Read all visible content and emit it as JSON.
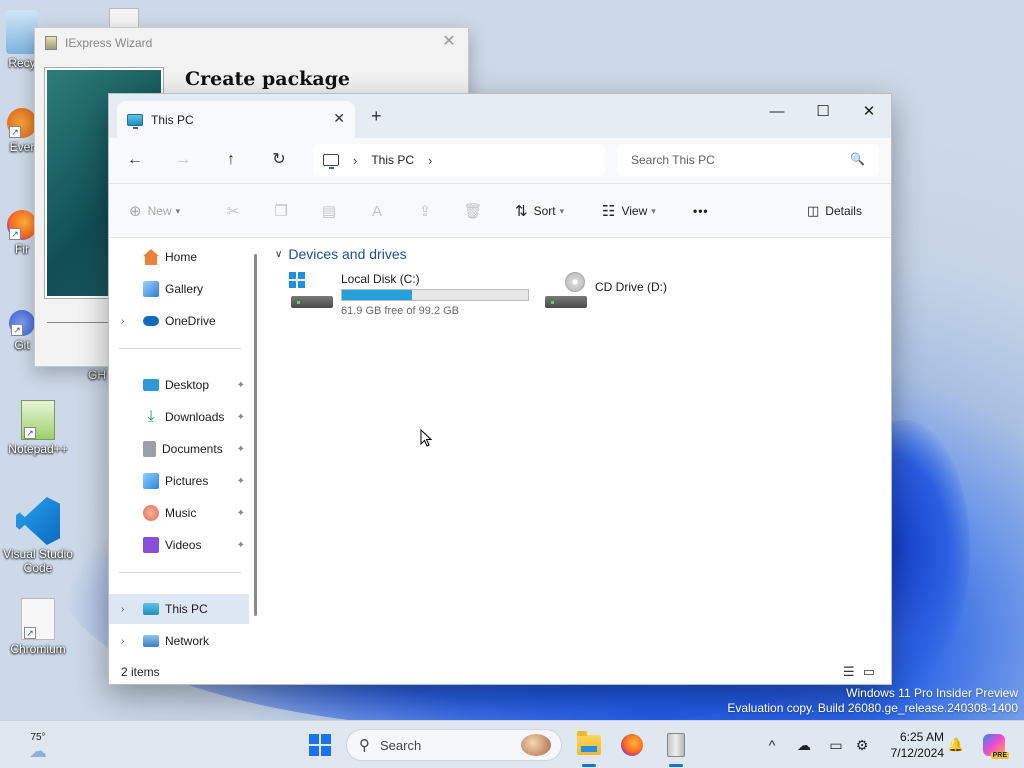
{
  "desktop": {
    "icons": [
      {
        "label": "Recy",
        "icon": "recycle-bin-icon"
      },
      {
        "label": "Ever",
        "icon": "everything-icon"
      },
      {
        "label": "Fir",
        "icon": "firefox-icon"
      },
      {
        "label": "Git",
        "icon": "git-icon"
      },
      {
        "label": "GH",
        "icon": "gh-icon"
      },
      {
        "label": "Notepad++",
        "icon": "notepad-plus-plus-icon"
      },
      {
        "label": "Visual Studio Code",
        "icon": "vscode-icon"
      },
      {
        "label": "Chromium",
        "icon": "chromium-icon"
      }
    ],
    "watermark_line1": "Windows 11 Pro Insider Preview",
    "watermark_line2": "Evaluation copy. Build 26080.ge_release.240308-1400"
  },
  "iexpress": {
    "title": "IExpress Wizard",
    "heading": "Create package",
    "close_glyph": "✕"
  },
  "explorer": {
    "tab_label": "This PC",
    "tab_close": "✕",
    "new_tab": "+",
    "window_controls": {
      "minimize": "—",
      "maximize": "☐",
      "close": "✕"
    },
    "nav_buttons": {
      "back": "←",
      "forward": "→",
      "up": "↑",
      "refresh": "↻"
    },
    "address": {
      "crumb": "This PC",
      "chev1": "›",
      "chev2": "›"
    },
    "search_placeholder": "Search This PC",
    "toolbar": {
      "new_label": "New",
      "sort_label": "Sort",
      "view_label": "View",
      "more_label": "•••",
      "details_label": "Details"
    },
    "sidebar": {
      "items": [
        {
          "label": "Home",
          "icon": "home-icon",
          "color": "#e8833a"
        },
        {
          "label": "Gallery",
          "icon": "gallery-icon",
          "color": "#2d7fd3"
        },
        {
          "label": "OneDrive",
          "icon": "onedrive-icon",
          "color": "#0f6cbd"
        },
        {
          "label": "Desktop",
          "icon": "desktop-icon",
          "color": "#2f9bd6"
        },
        {
          "label": "Downloads",
          "icon": "downloads-icon",
          "color": "#1f9a6a"
        },
        {
          "label": "Documents",
          "icon": "documents-icon",
          "color": "#8a8f99"
        },
        {
          "label": "Pictures",
          "icon": "pictures-icon",
          "color": "#2e86de"
        },
        {
          "label": "Music",
          "icon": "music-icon",
          "color": "#e06a4e"
        },
        {
          "label": "Videos",
          "icon": "videos-icon",
          "color": "#8a4fd8"
        },
        {
          "label": "This PC",
          "icon": "this-pc-icon",
          "color": "#2a9cd0"
        },
        {
          "label": "Network",
          "icon": "network-icon",
          "color": "#3a7ac0"
        }
      ],
      "pin_glyph": "📌",
      "expand_glyph": "›"
    },
    "content": {
      "group_title": "Devices and drives",
      "drives": [
        {
          "name": "Local Disk (C:)",
          "free_text": "61.9 GB free of 99.2 GB",
          "used_fraction": 0.376
        },
        {
          "name": "CD Drive (D:)"
        }
      ]
    },
    "status": {
      "item_count": "2 items"
    }
  },
  "taskbar": {
    "weather_temp": "75°",
    "search_label": "Search",
    "time": "6:25 AM",
    "date": "7/12/2024",
    "copilot_badge": "PRE",
    "tray_glyphs": {
      "chevron": "^",
      "cloud": "☁",
      "display": "▭",
      "settings": "⚙",
      "bell": "🔔"
    }
  }
}
